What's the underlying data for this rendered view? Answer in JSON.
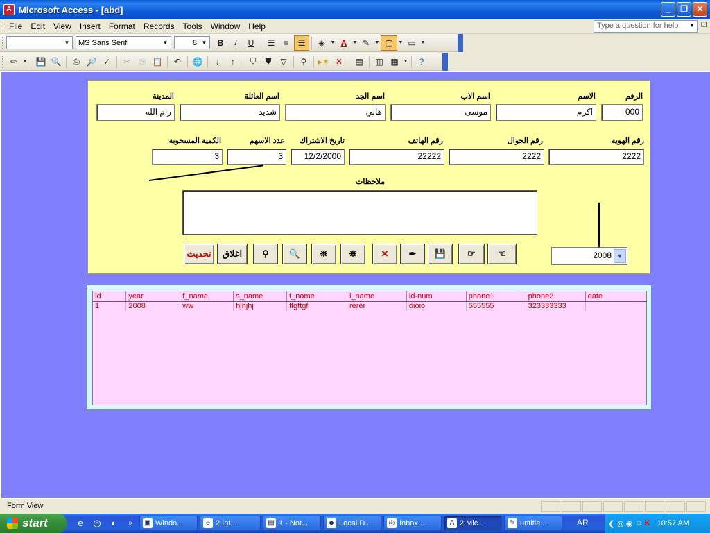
{
  "window": {
    "title": "Microsoft Access - [abd]",
    "app_icon": "access-icon",
    "minimize": "_",
    "maximize": "❐",
    "close": "✕"
  },
  "menubar": {
    "items": [
      "File",
      "Edit",
      "View",
      "Insert",
      "Format",
      "Records",
      "Tools",
      "Window",
      "Help"
    ],
    "help_placeholder": "Type a question for help"
  },
  "toolbar1": {
    "object_combo": "",
    "font_name": "MS Sans Serif",
    "font_size": "8",
    "bold": "B",
    "italic": "I",
    "underline": "U"
  },
  "form": {
    "labels": {
      "num": "الرقم",
      "name": "الاسم",
      "father": "اسم الاب",
      "grandfather": "اسم الجد",
      "family": "اسم العائلة",
      "city": "المدينة",
      "id_num": "رقم الهوية",
      "mobile": "رقم الجوال",
      "phone": "رقم الهاتف",
      "sub_date": "تاريخ الاشتراك",
      "shares": "عدد الاسهم",
      "withdrawn": "الكمية المسحوبة",
      "notes": "ملاحظات"
    },
    "values": {
      "num": "000",
      "name": "اكرم",
      "father": "موسى",
      "grandfather": "هاني",
      "family": "شديد",
      "city": "رام الله",
      "id_num": "2222",
      "mobile": "2222",
      "phone": "22222",
      "sub_date": "12/2/2000",
      "shares": "3",
      "withdrawn": "3",
      "notes": ""
    },
    "buttons": {
      "update": "تحديث",
      "close": "اغلاق"
    },
    "year": "2008"
  },
  "subform": {
    "columns": [
      "id",
      "year",
      "f_name",
      "s_name",
      "t_name",
      "l_name",
      "id-num",
      "phone1",
      "phone2",
      "date"
    ],
    "rows": [
      [
        "1",
        "2008",
        "ww",
        "hjhjhj",
        "ffgftgf",
        "rerer",
        "oioio",
        "555555",
        "323333333",
        ""
      ]
    ]
  },
  "statusbar": {
    "text": "Form View"
  },
  "taskbar": {
    "start": "start",
    "tasks": [
      "Windo...",
      "2 Int...",
      "1 - Not...",
      "Local D...",
      "Inbox ...",
      "2 Mic...",
      "untitle..."
    ],
    "language": "AR",
    "clock": "10:57 AM"
  },
  "colors": {
    "mdi_background": "#8080ff",
    "form_background": "#ffffa6",
    "datasheet_background": "#ffd6ff",
    "datasheet_text": "#d40000"
  }
}
